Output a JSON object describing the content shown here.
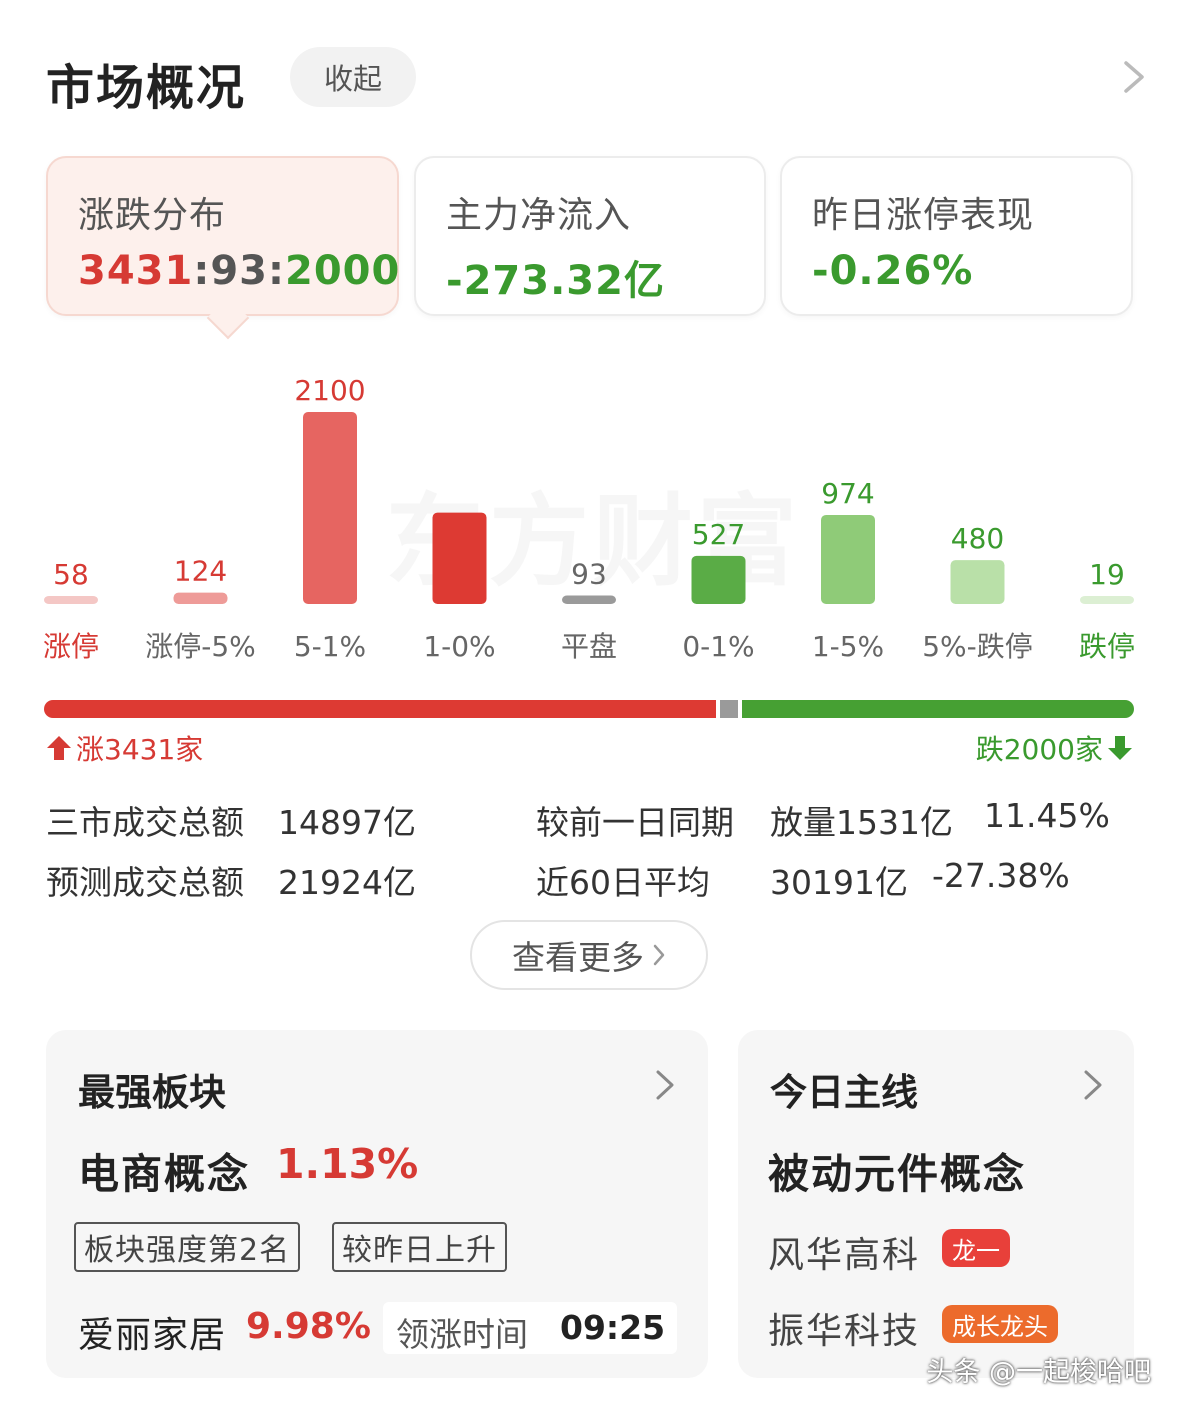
{
  "header": {
    "title": "市场概况",
    "collapse_label": "收起"
  },
  "cards": [
    {
      "label": "涨跌分布",
      "value_up": "3431",
      "sep1": ":",
      "value_flat": "93",
      "sep2": ":",
      "value_down": "2000"
    },
    {
      "label": "主力净流入",
      "value": "-273.32亿"
    },
    {
      "label": "昨日涨停表现",
      "value": "-0.26%"
    }
  ],
  "chart_data": {
    "type": "bar",
    "categories": [
      "涨停",
      "涨停-5%",
      "5-1%",
      "1-0%",
      "平盘",
      "0-1%",
      "1-5%",
      "5%-跌停",
      "跌停"
    ],
    "values": [
      58,
      124,
      2100,
      1000,
      93,
      527,
      974,
      480,
      19
    ],
    "data_labels": [
      "58",
      "124",
      "2100",
      "",
      "93",
      "527",
      "974",
      "480",
      "19"
    ],
    "colors": [
      "#f4c7c5",
      "#ee9b98",
      "#e66561",
      "#dd3a33",
      "#9a9a9a",
      "#5aac46",
      "#8fcb78",
      "#b9e0a8",
      "#dcefd3"
    ],
    "label_colors": [
      "#d63a34",
      "#666666",
      "#666666",
      "#666666",
      "#666666",
      "#666666",
      "#666666",
      "#666666",
      "#3a9a2e"
    ],
    "value_colors": [
      "#d63a34",
      "#d63a34",
      "#d63a34",
      "#d63a34",
      "#666666",
      "#3a9a2e",
      "#3a9a2e",
      "#3a9a2e",
      "#3a9a2e"
    ]
  },
  "watermark": "东方财富",
  "breadth": {
    "up_count": 3431,
    "flat_count": 93,
    "down_count": 2000,
    "up_label": "涨3431家",
    "down_label": "跌2000家"
  },
  "stats": {
    "row1_label": "三市成交总额",
    "row1_value": "14897亿",
    "row1_cmp_label": "较前一日同期",
    "row1_cmp_tag": "放量1531亿",
    "row1_cmp_pct": "11.45%",
    "row2_label": "预测成交总额",
    "row2_value": "21924亿",
    "row2_cmp_label": "近60日平均",
    "row2_cmp_value": "30191亿",
    "row2_cmp_pct": "-27.38%"
  },
  "more_button": "查看更多",
  "strongest": {
    "title": "最强板块",
    "sector": "电商概念",
    "sector_pct": "1.13%",
    "tag1": "板块强度第2名",
    "tag2": "较昨日上升",
    "stock": "爱丽家居",
    "stock_pct": "9.98%",
    "lead_time_label": "领涨时间",
    "lead_time": "09:25"
  },
  "mainline": {
    "title": "今日主线",
    "theme": "被动元件概念",
    "stock1": "风华高科",
    "badge1": "龙一",
    "stock2": "振华科技",
    "badge2": "成长龙头"
  },
  "footer_watermark": "头条 @一起梭哈吧"
}
